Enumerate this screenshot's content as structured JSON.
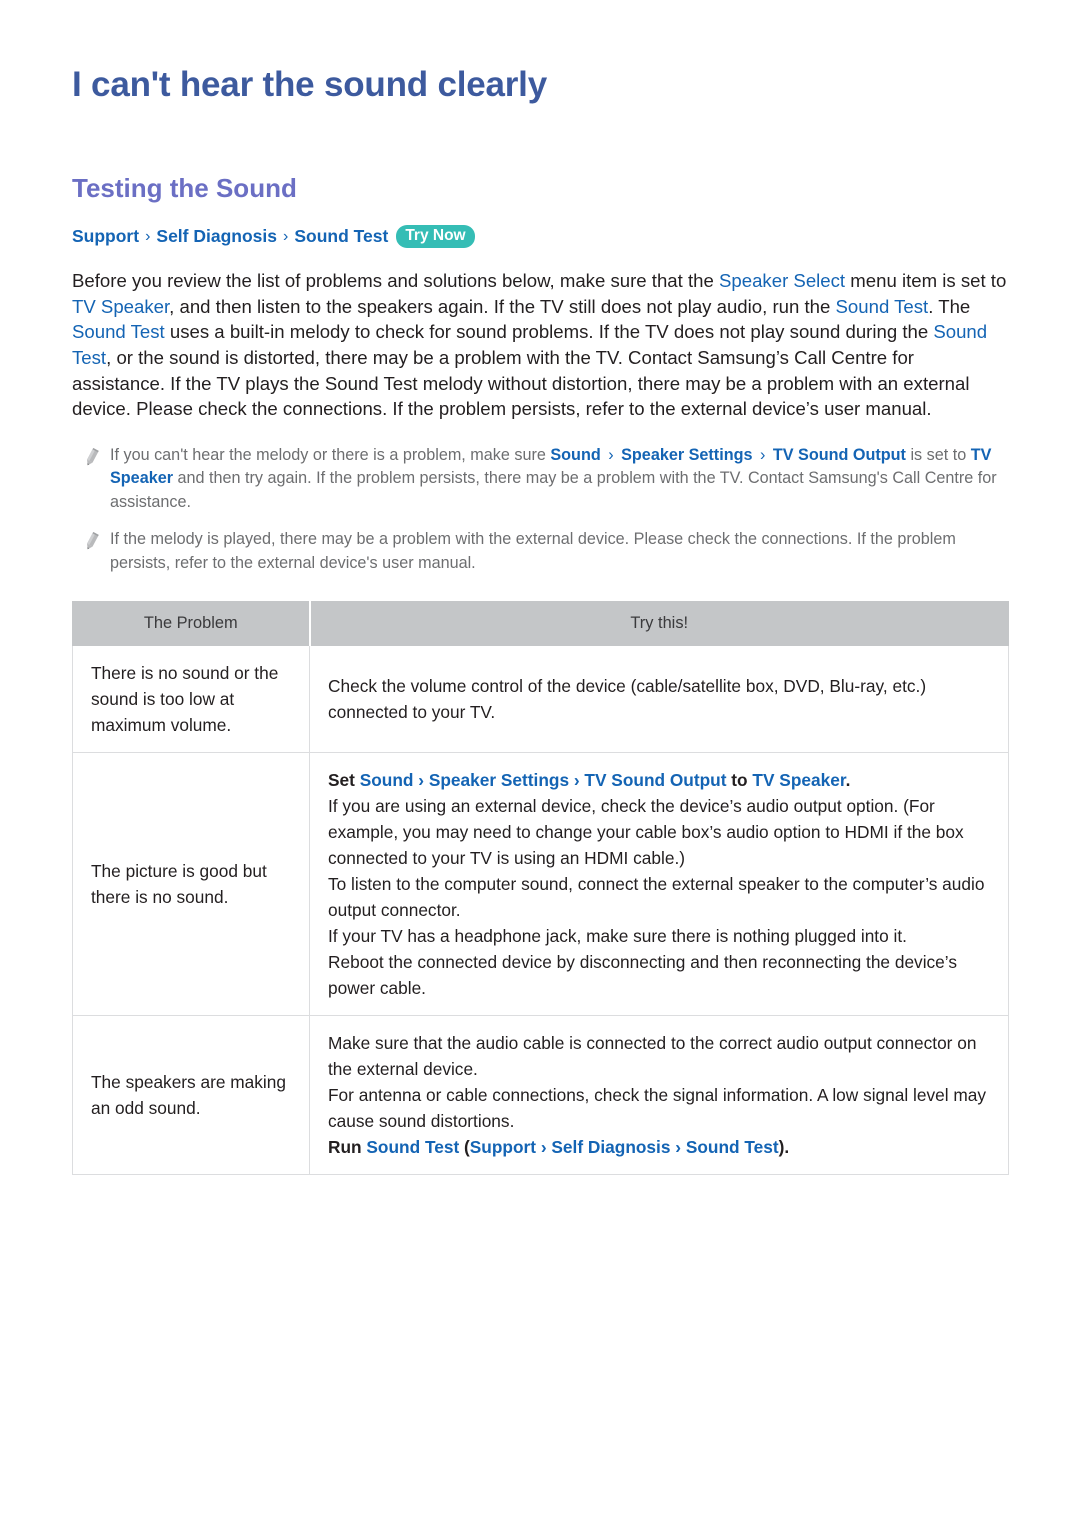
{
  "document": {
    "title": "I can't hear the sound clearly",
    "section_title": "Testing the Sound"
  },
  "breadcrumb": {
    "items": [
      "Support",
      "Self Diagnosis",
      "Sound Test"
    ],
    "separator": "›",
    "badge": "Try Now"
  },
  "intro": {
    "p1_a": "Before you review the list of problems and solutions below, make sure that the ",
    "p1_b": "Speaker Select",
    "p1_c": " menu item is set to ",
    "p1_d": "TV Speaker",
    "p1_e": ", and then listen to the speakers again. If the TV still does not play audio, run the ",
    "p1_f": "Sound Test",
    "p1_g": ". The ",
    "p1_h": "Sound Test",
    "p1_i": " uses a built-in melody to check for sound problems. If the TV does not play sound during the ",
    "p1_j": "Sound Test",
    "p1_k": ", or the sound is distorted, there may be a problem with the TV. Contact Samsung’s Call Centre for assistance. If the TV plays the Sound Test melody without distortion, there may be a problem with an external device. Please check the connections. If the problem persists, refer to the external device’s user manual."
  },
  "notes": [
    {
      "icon": "pencil-icon",
      "a": "If you can't hear the melody or there is a problem, make sure ",
      "l1": "Sound",
      "l2": "Speaker Settings",
      "l3": "TV Sound Output",
      "b": " is set to ",
      "l4": "TV Speaker",
      "c": " and then try again. If the problem persists, there may be a problem with the TV. Contact Samsung's Call Centre for assistance."
    },
    {
      "icon": "pencil-icon",
      "a": "If the melody is played, there may be a problem with the external device. Please check the connections. If the problem persists, refer to the external device's user manual.",
      "l1": "",
      "l2": "",
      "l3": "",
      "b": "",
      "l4": "",
      "c": ""
    }
  ],
  "table": {
    "headers": [
      "The Problem",
      "Try this!"
    ],
    "rows": [
      {
        "problem": "There is no sound or the sound is too low at maximum volume.",
        "lines": [
          {
            "bold": false,
            "segs": [
              {
                "t": "Check the volume control of the device (cable/satellite box, DVD, Blu-ray, etc.) connected to your TV.",
                "link": false
              }
            ]
          }
        ]
      },
      {
        "problem": "The picture is good but there is no sound.",
        "lines": [
          {
            "bold": true,
            "segs": [
              {
                "t": "Set ",
                "link": false
              },
              {
                "t": "Sound",
                "link": true
              },
              {
                "t": " › ",
                "link": true
              },
              {
                "t": "Speaker Settings",
                "link": true
              },
              {
                "t": " › ",
                "link": true
              },
              {
                "t": "TV Sound Output",
                "link": true
              },
              {
                "t": " to ",
                "link": false
              },
              {
                "t": "TV Speaker",
                "link": true
              },
              {
                "t": ".",
                "link": false
              }
            ]
          },
          {
            "bold": false,
            "segs": [
              {
                "t": "If you are using an external device, check the device’s audio output option. (For example, you may need to change your cable box’s audio option to HDMI if the box connected to your TV is using an HDMI cable.)",
                "link": false
              }
            ]
          },
          {
            "bold": false,
            "segs": [
              {
                "t": "To listen to the computer sound, connect the external speaker to the computer’s audio output connector.",
                "link": false
              }
            ]
          },
          {
            "bold": false,
            "segs": [
              {
                "t": "If your TV has a headphone jack, make sure there is nothing plugged into it.",
                "link": false
              }
            ]
          },
          {
            "bold": false,
            "segs": [
              {
                "t": "Reboot the connected device by disconnecting and then reconnecting the device’s power cable.",
                "link": false
              }
            ]
          }
        ]
      },
      {
        "problem": "The speakers are making an odd sound.",
        "lines": [
          {
            "bold": false,
            "segs": [
              {
                "t": "Make sure that the audio cable is connected to the correct audio output connector on the external device.",
                "link": false
              }
            ]
          },
          {
            "bold": false,
            "segs": [
              {
                "t": "For antenna or cable connections, check the signal information. A low signal level may cause sound distortions.",
                "link": false
              }
            ]
          },
          {
            "bold": true,
            "segs": [
              {
                "t": "Run ",
                "link": false
              },
              {
                "t": "Sound Test",
                "link": true
              },
              {
                "t": " (",
                "link": false
              },
              {
                "t": "Support",
                "link": true
              },
              {
                "t": " › ",
                "link": true
              },
              {
                "t": "Self Diagnosis",
                "link": true
              },
              {
                "t": " › ",
                "link": true
              },
              {
                "t": "Sound Test",
                "link": true
              },
              {
                "t": ").",
                "link": false
              }
            ]
          }
        ]
      }
    ]
  },
  "colors": {
    "title": "#3d5a9e",
    "section_title": "#6b6fc4",
    "link": "#1464b4",
    "badge_bg": "#35bdb5",
    "table_header_bg": "#c4c6c8",
    "note_text": "#6d6e70",
    "body_text": "#231f20"
  }
}
